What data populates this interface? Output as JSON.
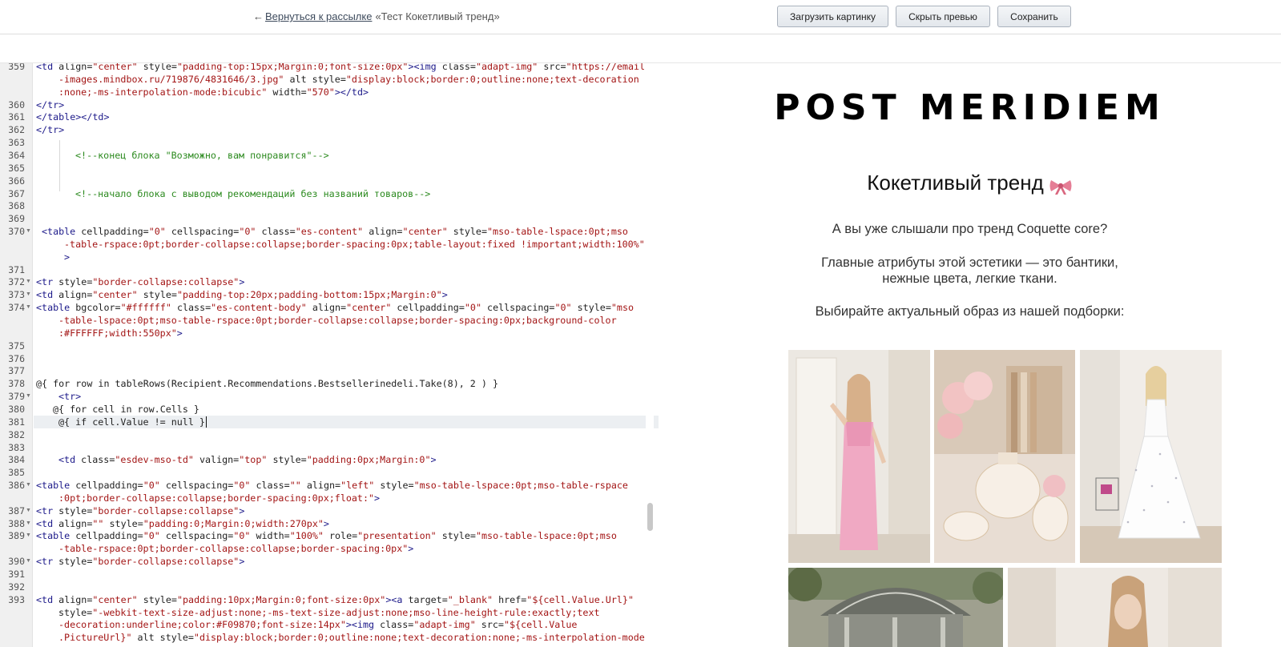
{
  "topbar": {
    "back_arrow": "←",
    "back_link": "Вернуться к рассылке",
    "mailing_title": "«Тест Кокетливый тренд»",
    "upload_button": "Загрузить картинку",
    "hide_preview_button": "Скрыть превью",
    "save_button": "Сохранить"
  },
  "editor": {
    "lines": [
      {
        "num": "359",
        "parts": [
          [
            "tag",
            "<td "
          ],
          [
            "attr",
            "align="
          ],
          [
            "val",
            "\"center\" "
          ],
          [
            "attr",
            "style="
          ],
          [
            "val",
            "\"padding-top:15px;Margin:0;font-size:0px\""
          ],
          [
            "tag",
            "><img "
          ],
          [
            "attr",
            "class="
          ],
          [
            "val",
            "\"adapt-img\" "
          ],
          [
            "attr",
            "src="
          ],
          [
            "val",
            "\"https://email"
          ]
        ]
      },
      {
        "num": "",
        "indent": 4,
        "parts": [
          [
            "val",
            "-images.mindbox.ru/719876/4831646/3.jpg\" "
          ],
          [
            "attr",
            "alt "
          ],
          [
            "attr",
            "style="
          ],
          [
            "val",
            "\"display:block;border:0;outline:none;text-decoration"
          ]
        ]
      },
      {
        "num": "",
        "indent": 4,
        "parts": [
          [
            "val",
            ":none;-ms-interpolation-mode:bicubic\" "
          ],
          [
            "attr",
            "width="
          ],
          [
            "val",
            "\"570\""
          ],
          [
            "tag",
            "></td>"
          ]
        ]
      },
      {
        "num": "360",
        "parts": [
          [
            "tag",
            "</tr>"
          ]
        ]
      },
      {
        "num": "361",
        "parts": [
          [
            "tag",
            "</table></td>"
          ]
        ]
      },
      {
        "num": "362",
        "parts": [
          [
            "tag",
            "</tr>"
          ]
        ]
      },
      {
        "num": "363",
        "parts": []
      },
      {
        "num": "364",
        "indent": 7,
        "parts": [
          [
            "cmt",
            "<!--конец блока \"Возможно, вам понравится\"-->"
          ]
        ]
      },
      {
        "num": "365",
        "parts": []
      },
      {
        "num": "366",
        "parts": []
      },
      {
        "num": "367",
        "indent": 7,
        "parts": [
          [
            "cmt",
            "<!--начало блока с выводом рекомендаций без названий товаров-->"
          ]
        ]
      },
      {
        "num": "368",
        "parts": []
      },
      {
        "num": "369",
        "parts": []
      },
      {
        "num": "370",
        "fold": true,
        "indent": 1,
        "parts": [
          [
            "tag",
            "<table "
          ],
          [
            "attr",
            "cellpadding="
          ],
          [
            "val",
            "\"0\" "
          ],
          [
            "attr",
            "cellspacing="
          ],
          [
            "val",
            "\"0\" "
          ],
          [
            "attr",
            "class="
          ],
          [
            "val",
            "\"es-content\" "
          ],
          [
            "attr",
            "align="
          ],
          [
            "val",
            "\"center\" "
          ],
          [
            "attr",
            "style="
          ],
          [
            "val",
            "\"mso-table-lspace:0pt;mso"
          ]
        ]
      },
      {
        "num": "",
        "indent": 5,
        "parts": [
          [
            "val",
            "-table-rspace:0pt;border-collapse:collapse;border-spacing:0px;table-layout:fixed !important;width:100%\""
          ]
        ]
      },
      {
        "num": "",
        "indent": 5,
        "parts": [
          [
            "tag",
            ">"
          ]
        ]
      },
      {
        "num": "371",
        "parts": []
      },
      {
        "num": "372",
        "fold": true,
        "parts": [
          [
            "tag",
            "<tr "
          ],
          [
            "attr",
            "style="
          ],
          [
            "val",
            "\"border-collapse:collapse\""
          ],
          [
            "tag",
            ">"
          ]
        ]
      },
      {
        "num": "373",
        "fold": true,
        "parts": [
          [
            "tag",
            "<td "
          ],
          [
            "attr",
            "align="
          ],
          [
            "val",
            "\"center\" "
          ],
          [
            "attr",
            "style="
          ],
          [
            "val",
            "\"padding-top:20px;padding-bottom:15px;Margin:0\""
          ],
          [
            "tag",
            ">"
          ]
        ]
      },
      {
        "num": "374",
        "fold": true,
        "parts": [
          [
            "tag",
            "<table "
          ],
          [
            "attr",
            "bgcolor="
          ],
          [
            "val",
            "\"#ffffff\" "
          ],
          [
            "attr",
            "class="
          ],
          [
            "val",
            "\"es-content-body\" "
          ],
          [
            "attr",
            "align="
          ],
          [
            "val",
            "\"center\" "
          ],
          [
            "attr",
            "cellpadding="
          ],
          [
            "val",
            "\"0\" "
          ],
          [
            "attr",
            "cellspacing="
          ],
          [
            "val",
            "\"0\" "
          ],
          [
            "attr",
            "style="
          ],
          [
            "val",
            "\"mso"
          ]
        ]
      },
      {
        "num": "",
        "indent": 4,
        "parts": [
          [
            "val",
            "-table-lspace:0pt;mso-table-rspace:0pt;border-collapse:collapse;border-spacing:0px;background-color"
          ]
        ]
      },
      {
        "num": "",
        "indent": 4,
        "parts": [
          [
            "val",
            ":#FFFFFF;width:550px\""
          ],
          [
            "tag",
            ">"
          ]
        ]
      },
      {
        "num": "375",
        "parts": []
      },
      {
        "num": "376",
        "parts": []
      },
      {
        "num": "377",
        "parts": []
      },
      {
        "num": "378",
        "parts": [
          [
            "txt",
            "@{ for row in tableRows(Recipient.Recommendations.Bestsellerinedeli.Take(8), 2 ) }"
          ]
        ]
      },
      {
        "num": "379",
        "fold": true,
        "indent": 4,
        "parts": [
          [
            "tag",
            "<tr>"
          ]
        ]
      },
      {
        "num": "380",
        "indent": 3,
        "parts": [
          [
            "txt",
            "@{ for cell in row.Cells }"
          ]
        ]
      },
      {
        "num": "381",
        "indent": 4,
        "active": true,
        "parts": [
          [
            "txt",
            "@{ if cell.Value != null }"
          ]
        ]
      },
      {
        "num": "382",
        "parts": []
      },
      {
        "num": "383",
        "parts": []
      },
      {
        "num": "384",
        "indent": 4,
        "parts": [
          [
            "tag",
            "<td "
          ],
          [
            "attr",
            "class="
          ],
          [
            "val",
            "\"esdev-mso-td\" "
          ],
          [
            "attr",
            "valign="
          ],
          [
            "val",
            "\"top\" "
          ],
          [
            "attr",
            "style="
          ],
          [
            "val",
            "\"padding:0px;Margin:0\""
          ],
          [
            "tag",
            ">"
          ]
        ]
      },
      {
        "num": "385",
        "parts": []
      },
      {
        "num": "386",
        "fold": true,
        "parts": [
          [
            "tag",
            "<table "
          ],
          [
            "attr",
            "cellpadding="
          ],
          [
            "val",
            "\"0\" "
          ],
          [
            "attr",
            "cellspacing="
          ],
          [
            "val",
            "\"0\" "
          ],
          [
            "attr",
            "class="
          ],
          [
            "val",
            "\"\" "
          ],
          [
            "attr",
            "align="
          ],
          [
            "val",
            "\"left\" "
          ],
          [
            "attr",
            "style="
          ],
          [
            "val",
            "\"mso-table-lspace:0pt;mso-table-rspace"
          ]
        ]
      },
      {
        "num": "",
        "indent": 4,
        "parts": [
          [
            "val",
            ":0pt;border-collapse:collapse;border-spacing:0px;float:\""
          ],
          [
            "tag",
            ">"
          ]
        ]
      },
      {
        "num": "387",
        "fold": true,
        "parts": [
          [
            "tag",
            "<tr "
          ],
          [
            "attr",
            "style="
          ],
          [
            "val",
            "\"border-collapse:collapse\""
          ],
          [
            "tag",
            ">"
          ]
        ]
      },
      {
        "num": "388",
        "fold": true,
        "parts": [
          [
            "tag",
            "<td "
          ],
          [
            "attr",
            "align="
          ],
          [
            "val",
            "\"\" "
          ],
          [
            "attr",
            "style="
          ],
          [
            "val",
            "\"padding:0;Margin:0;width:270px\""
          ],
          [
            "tag",
            ">"
          ]
        ]
      },
      {
        "num": "389",
        "fold": true,
        "parts": [
          [
            "tag",
            "<table "
          ],
          [
            "attr",
            "cellpadding="
          ],
          [
            "val",
            "\"0\" "
          ],
          [
            "attr",
            "cellspacing="
          ],
          [
            "val",
            "\"0\" "
          ],
          [
            "attr",
            "width="
          ],
          [
            "val",
            "\"100%\" "
          ],
          [
            "attr",
            "role="
          ],
          [
            "val",
            "\"presentation\" "
          ],
          [
            "attr",
            "style="
          ],
          [
            "val",
            "\"mso-table-lspace:0pt;mso"
          ]
        ]
      },
      {
        "num": "",
        "indent": 4,
        "parts": [
          [
            "val",
            "-table-rspace:0pt;border-collapse:collapse;border-spacing:0px\""
          ],
          [
            "tag",
            ">"
          ]
        ]
      },
      {
        "num": "390",
        "fold": true,
        "parts": [
          [
            "tag",
            "<tr "
          ],
          [
            "attr",
            "style="
          ],
          [
            "val",
            "\"border-collapse:collapse\""
          ],
          [
            "tag",
            ">"
          ]
        ]
      },
      {
        "num": "391",
        "parts": []
      },
      {
        "num": "392",
        "parts": []
      },
      {
        "num": "393",
        "parts": [
          [
            "tag",
            "<td "
          ],
          [
            "attr",
            "align="
          ],
          [
            "val",
            "\"center\" "
          ],
          [
            "attr",
            "style="
          ],
          [
            "val",
            "\"padding:10px;Margin:0;font-size:0px\""
          ],
          [
            "tag",
            "><a "
          ],
          [
            "attr",
            "target="
          ],
          [
            "val",
            "\"_blank\" "
          ],
          [
            "attr",
            "href="
          ],
          [
            "val",
            "\"${cell.Value.Url}\""
          ]
        ]
      },
      {
        "num": "",
        "indent": 4,
        "parts": [
          [
            "attr",
            "style="
          ],
          [
            "val",
            "\"-webkit-text-size-adjust:none;-ms-text-size-adjust:none;mso-line-height-rule:exactly;text"
          ]
        ]
      },
      {
        "num": "",
        "indent": 4,
        "parts": [
          [
            "val",
            "-decoration:underline;color:#F09870;font-size:14px\""
          ],
          [
            "tag",
            "><img "
          ],
          [
            "attr",
            "class="
          ],
          [
            "val",
            "\"adapt-img\" "
          ],
          [
            "attr",
            "src="
          ],
          [
            "val",
            "\"${cell.Value"
          ]
        ]
      },
      {
        "num": "",
        "indent": 4,
        "parts": [
          [
            "val",
            ".PictureUrl}\" "
          ],
          [
            "attr",
            "alt "
          ],
          [
            "attr",
            "style="
          ],
          [
            "val",
            "\"display:block;border:0;outline:none;text-decoration:none;-ms-interpolation-mode"
          ]
        ]
      }
    ]
  },
  "preview": {
    "brand": "POST MERIDIEM",
    "heading": "Кокетливый тренд",
    "heading_icon": "bow-icon",
    "para1": "А вы уже слышали про тренд Coquette core?",
    "para2_line1": "Главные атрибуты этой эстетики — это бантики,",
    "para2_line2": "нежные цвета, легкие ткани.",
    "para3": "Выбирайте актуальный образ из нашей подборки:",
    "photos": [
      {
        "name": "photo-pink-dress"
      },
      {
        "name": "photo-tea-set"
      },
      {
        "name": "photo-white-dress"
      },
      {
        "name": "photo-gazebo"
      },
      {
        "name": "photo-woman-portrait"
      }
    ]
  },
  "colors": {
    "tag": "#1d1a8a",
    "value": "#a31515",
    "comment": "#2c8a1f",
    "accent_bow": "#e57d95"
  }
}
